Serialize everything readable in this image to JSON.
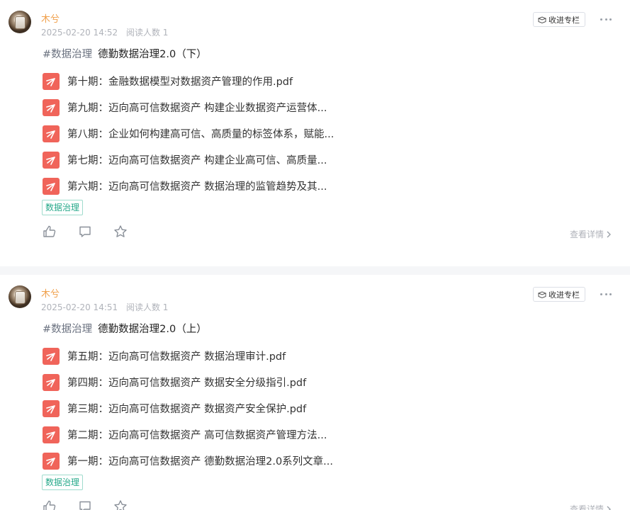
{
  "posts": [
    {
      "author": "木兮",
      "timestamp": "2025-02-20 14:52",
      "readers": "阅读人数 1",
      "collect_label": "收进专栏",
      "hashtag": "#数据治理",
      "title": "德勤数据治理2.0（下）",
      "files": [
        "第十期：金融数据模型对数据资产管理的作用.pdf",
        "第九期：迈向高可信数据资产 构建企业数据资产运营体...",
        "第八期：企业如何构建高可信、高质量的标签体系，赋能...",
        "第七期：迈向高可信数据资产 构建企业高可信、高质量...",
        "第六期：迈向高可信数据资产 数据治理的监管趋势及其..."
      ],
      "topic": "数据治理",
      "details_label": "查看详情"
    },
    {
      "author": "木兮",
      "timestamp": "2025-02-20 14:51",
      "readers": "阅读人数 1",
      "collect_label": "收进专栏",
      "hashtag": "#数据治理",
      "title": "德勤数据治理2.0（上）",
      "files": [
        "第五期：迈向高可信数据资产 数据治理审计.pdf",
        "第四期：迈向高可信数据资产 数据安全分级指引.pdf",
        "第三期：迈向高可信数据资产 数据资产安全保护.pdf",
        "第二期：迈向高可信数据资产 高可信数据资产管理方法...",
        "第一期：迈向高可信数据资产 德勤数据治理2.0系列文章..."
      ],
      "topic": "数据治理",
      "details_label": "查看详情"
    }
  ],
  "colors": {
    "author": "#f0a04b",
    "pdf_icon": "#f0645a",
    "topic": "#26a98a",
    "muted": "#b0b3ba"
  },
  "icons": {
    "collect": "box-icon",
    "more": "more-dots-icon",
    "pdf": "pdf-icon",
    "like": "thumbs-up-icon",
    "comment": "comment-icon",
    "favorite": "star-icon",
    "details_arrow": "chevron-right-icon"
  }
}
